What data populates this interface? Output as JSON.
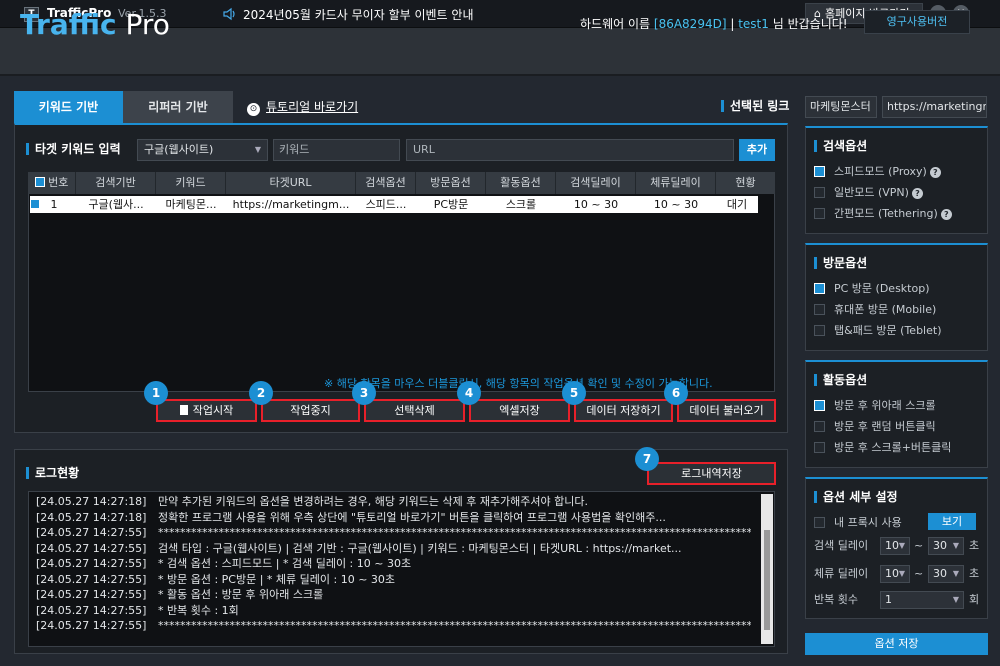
{
  "titlebar": {
    "app_icon": "T",
    "app_name": "TrafficPro",
    "version": "Ver.1.5.3",
    "speaker_icon": "speaker-icon",
    "notice": "2024년05월 카드사 무이자 할부 이벤트 안내",
    "home_button": "홈페이지 바로가기",
    "minimize": "−",
    "close": "×"
  },
  "header": {
    "logo_main": "Traffic",
    "logo_sub": " Pro",
    "hw_prefix": "하드웨어 이름",
    "hw_id": "[86A8294D]",
    "separator": "|",
    "user": "test1",
    "greeting": "님 반갑습니다!",
    "perm_button": "영구사용버전"
  },
  "tabs": {
    "keyword": "키워드 기반",
    "referrer": "리퍼러 기반",
    "tutorial": "튜토리얼 바로가기"
  },
  "target": {
    "label": "타겟 키워드 입력",
    "engine_value": "구글(웹사이트)",
    "keyword_placeholder": "키워드",
    "url_placeholder": "URL",
    "add_button": "추가"
  },
  "table": {
    "headers": [
      "번호",
      "검색기반",
      "키워드",
      "타겟URL",
      "검색옵션",
      "방문옵션",
      "활동옵션",
      "검색딜레이",
      "체류딜레이",
      "현황"
    ],
    "rows": [
      [
        "1",
        "구글(웹사...",
        "마케팅몬...",
        "https://marketingm...",
        "스피드...",
        "PC방문",
        "스크롤",
        "10 ~ 30",
        "10 ~ 30",
        "대기"
      ]
    ],
    "note": "※ 해당 항목을 마우스 더블클릭시, 해당 항목의 작업옵션 확인 및 수정이 가능합니다."
  },
  "actions": {
    "start": "작업시작",
    "stop": "작업중지",
    "delete": "선택삭제",
    "excel": "엑셀저장",
    "save_data": "데이터 저장하기",
    "load_data": "데이터 불러오기",
    "badges": [
      "1",
      "2",
      "3",
      "4",
      "5",
      "6",
      "7"
    ]
  },
  "log": {
    "label": "로그현황",
    "save_button": "로그내역저장",
    "lines": [
      {
        "ts": "[24.05.27 14:27:18]",
        "msg": "만약 추가된 키워드의 옵션을 변경하려는 경우, 해당 키워드는 삭제 후 재추가해주셔야 합니다."
      },
      {
        "ts": "[24.05.27 14:27:18]",
        "msg": "정확한 프로그램 사용을 위해 우측 상단에 \"튜토리얼 바로가기\" 버튼을 클릭하여 프로그램 사용법을 확인해주..."
      },
      {
        "ts": "[24.05.27 14:27:55]",
        "msg": "**************************************************************************************************************"
      },
      {
        "ts": "[24.05.27 14:27:55]",
        "msg": "검색 타입 : 구글(웹사이트) | 검색 기반 : 구글(웹사이트) | 키워드 : 마케팅몬스터 | 타겟URL : https://market..."
      },
      {
        "ts": "[24.05.27 14:27:55]",
        "msg": "* 검색 옵션 : 스피드모드 | * 검색 딜레이 : 10 ~ 30초"
      },
      {
        "ts": "[24.05.27 14:27:55]",
        "msg": "* 방문 옵션 : PC방문 | * 체류 딜레이 : 10 ~ 30초"
      },
      {
        "ts": "[24.05.27 14:27:55]",
        "msg": "* 활동 옵션 : 방문 후 위아래 스크롤"
      },
      {
        "ts": "[24.05.27 14:27:55]",
        "msg": "* 반복 횟수 : 1회"
      },
      {
        "ts": "[24.05.27 14:27:55]",
        "msg": "**************************************************************************************************************"
      }
    ]
  },
  "right": {
    "selected_link_label": "선택된 링크",
    "selected_keyword": "마케팅몬스터",
    "selected_url": "https://marketingmonster",
    "search_options": {
      "title": "검색옵션",
      "items": [
        {
          "label": "스피드모드 (Proxy)",
          "checked": true
        },
        {
          "label": "일반모드 (VPN)",
          "checked": false
        },
        {
          "label": "간편모드 (Tethering)",
          "checked": false
        }
      ]
    },
    "visit_options": {
      "title": "방문옵션",
      "items": [
        {
          "label": "PC 방문 (Desktop)",
          "checked": true
        },
        {
          "label": "휴대폰 방문 (Mobile)",
          "checked": false
        },
        {
          "label": "탭&패드 방문 (Teblet)",
          "checked": false
        }
      ]
    },
    "activity_options": {
      "title": "활동옵션",
      "items": [
        {
          "label": "방문 후 위아래 스크롤",
          "checked": true
        },
        {
          "label": "방문 후 랜덤 버튼클릭",
          "checked": false
        },
        {
          "label": "방문 후 스크롤+버튼클릭",
          "checked": false
        }
      ]
    },
    "detail": {
      "title": "옵션 세부 설정",
      "proxy_label": "내 프록시 사용",
      "view_button": "보기",
      "search_delay_label": "검색 딜레이",
      "search_delay_from": "10",
      "search_delay_to": "30",
      "stay_delay_label": "체류 딜레이",
      "stay_delay_from": "10",
      "stay_delay_to": "30",
      "repeat_label": "반복 횟수",
      "repeat_value": "1",
      "tilde": "~",
      "sec_unit": "초",
      "count_unit": "회"
    },
    "save_options": "옵션 저장"
  },
  "colors": {
    "accent": "#1c8fd3",
    "highlight_border": "#e8202a",
    "background": "#232830"
  }
}
